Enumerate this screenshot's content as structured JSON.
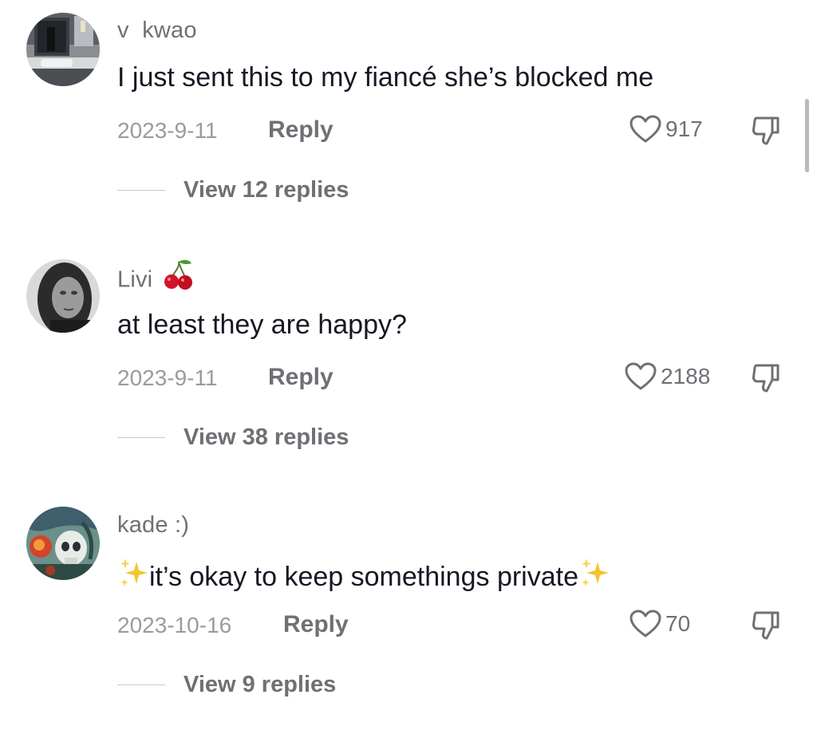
{
  "comments": [
    {
      "username": "v  kwao",
      "text": "I just sent this to my fiancé she’s blocked me",
      "date": "2023-9-11",
      "reply_label": "Reply",
      "likes": "917",
      "view_replies": "View 12 replies",
      "avatar_icon": "bathroom-mirror-selfie-avatar"
    },
    {
      "username": "Livi",
      "username_emoji": "cherries-icon",
      "text": "at least they are happy?",
      "date": "2023-9-11",
      "reply_label": "Reply",
      "likes": "2188",
      "view_replies": "View 38 replies",
      "avatar_icon": "grayscale-portrait-avatar"
    },
    {
      "username": "kade :)",
      "text": "it’s okay to keep somethings private",
      "text_emoji": "sparkles-icon",
      "date": "2023-10-16",
      "reply_label": "Reply",
      "likes": "70",
      "view_replies": "View 9 replies",
      "avatar_icon": "skull-artwork-avatar"
    }
  ],
  "icons": {
    "like": "heart-outline-icon",
    "dislike": "thumbs-down-icon"
  },
  "colors": {
    "primary_text": "#161823",
    "secondary_text": "#6f7075",
    "muted_text": "#9a9ba1",
    "background": "#ffffff",
    "cherry_red": "#d3142a",
    "sparkle_gold": "#f4c430"
  }
}
